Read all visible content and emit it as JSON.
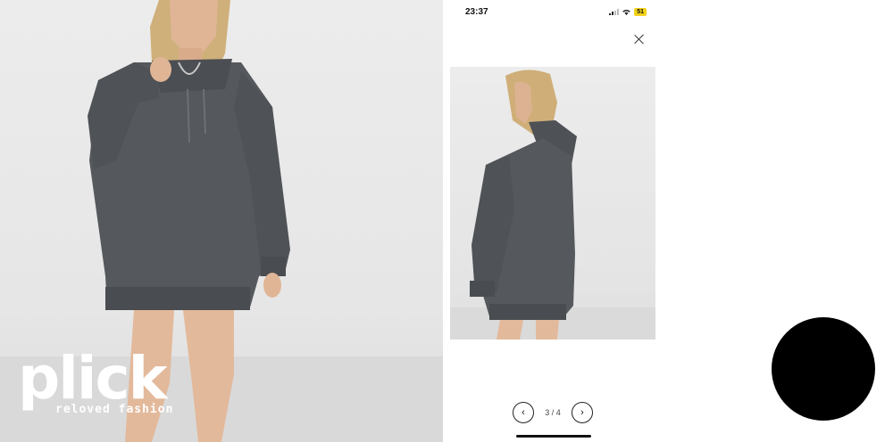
{
  "hero": {
    "image": "model wearing oversized grey hoodie dress, front view"
  },
  "logo": {
    "wordmark": "plick",
    "tagline": "reloved fashion"
  },
  "status_bar": {
    "time": "23:37",
    "battery": "51"
  },
  "viewer": {
    "close_icon": "close-icon",
    "image": "model wearing grey hoodie dress, back view",
    "counter": "3 / 4",
    "prev_icon": "chevron-left-icon",
    "next_icon": "chevron-right-icon",
    "prev_glyph": "‹",
    "next_glyph": "›"
  },
  "colors": {
    "hoodie": "#55585c",
    "battery": "#f2d21b"
  }
}
